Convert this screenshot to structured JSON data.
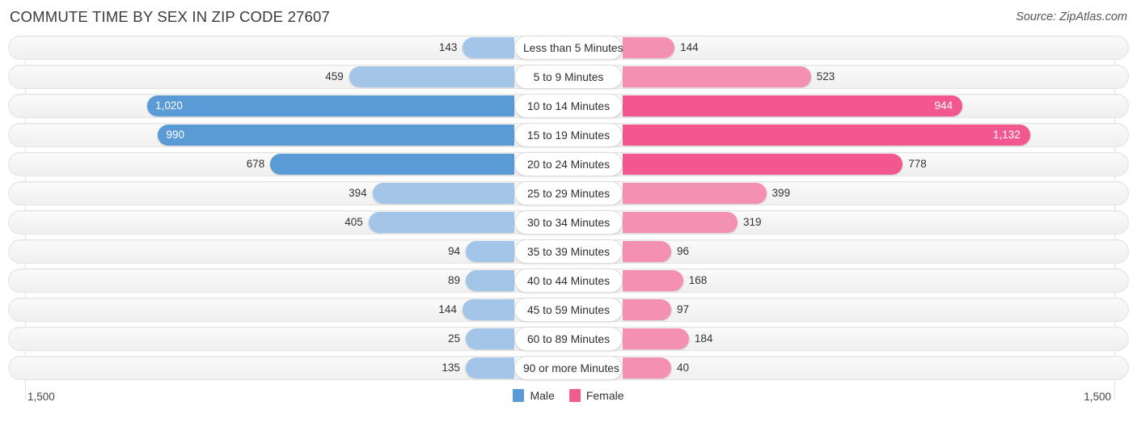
{
  "header": {
    "title": "COMMUTE TIME BY SEX IN ZIP CODE 27607",
    "source": "Source: ZipAtlas.com"
  },
  "legend": {
    "male_label": "Male",
    "female_label": "Female",
    "male_color": "#5B9BD5",
    "female_color": "#EE5E8C"
  },
  "axis": {
    "left_max": "1,500",
    "right_max": "1,500",
    "max_value": 1500
  },
  "palette": {
    "male_light": "#A3C6E8",
    "male_dark": "#5B9BD5",
    "female_light": "#F490B1",
    "female_dark": "#F2578F"
  },
  "chart_data": {
    "type": "bar",
    "title": "COMMUTE TIME BY SEX IN ZIP CODE 27607",
    "subtitle": "Source: ZipAtlas.com",
    "orientation": "horizontal-diverging",
    "xlabel": "",
    "ylabel": "",
    "xlim": [
      1500,
      1500
    ],
    "grid": true,
    "legend_position": "bottom-center",
    "categories": [
      "Less than 5 Minutes",
      "5 to 9 Minutes",
      "10 to 14 Minutes",
      "15 to 19 Minutes",
      "20 to 24 Minutes",
      "25 to 29 Minutes",
      "30 to 34 Minutes",
      "35 to 39 Minutes",
      "40 to 44 Minutes",
      "45 to 59 Minutes",
      "60 to 89 Minutes",
      "90 or more Minutes"
    ],
    "series": [
      {
        "name": "Male",
        "color": "#5B9BD5",
        "values": [
          143,
          459,
          1020,
          990,
          678,
          394,
          405,
          94,
          89,
          144,
          25,
          135
        ]
      },
      {
        "name": "Female",
        "color": "#EE5E8C",
        "values": [
          144,
          523,
          944,
          1132,
          778,
          399,
          319,
          96,
          168,
          97,
          184,
          40
        ]
      }
    ]
  },
  "rows": [
    {
      "label": "Less than 5 Minutes",
      "male": {
        "value": 143,
        "text": "143",
        "inside": false,
        "dark": false
      },
      "female": {
        "value": 144,
        "text": "144",
        "inside": false,
        "dark": false
      }
    },
    {
      "label": "5 to 9 Minutes",
      "male": {
        "value": 459,
        "text": "459",
        "inside": false,
        "dark": false
      },
      "female": {
        "value": 523,
        "text": "523",
        "inside": false,
        "dark": false
      }
    },
    {
      "label": "10 to 14 Minutes",
      "male": {
        "value": 1020,
        "text": "1,020",
        "inside": true,
        "dark": true
      },
      "female": {
        "value": 944,
        "text": "944",
        "inside": true,
        "dark": true
      }
    },
    {
      "label": "15 to 19 Minutes",
      "male": {
        "value": 990,
        "text": "990",
        "inside": true,
        "dark": true
      },
      "female": {
        "value": 1132,
        "text": "1,132",
        "inside": true,
        "dark": true
      }
    },
    {
      "label": "20 to 24 Minutes",
      "male": {
        "value": 678,
        "text": "678",
        "inside": false,
        "dark": true
      },
      "female": {
        "value": 778,
        "text": "778",
        "inside": false,
        "dark": true
      }
    },
    {
      "label": "25 to 29 Minutes",
      "male": {
        "value": 394,
        "text": "394",
        "inside": false,
        "dark": false
      },
      "female": {
        "value": 399,
        "text": "399",
        "inside": false,
        "dark": false
      }
    },
    {
      "label": "30 to 34 Minutes",
      "male": {
        "value": 405,
        "text": "405",
        "inside": false,
        "dark": false
      },
      "female": {
        "value": 319,
        "text": "319",
        "inside": false,
        "dark": false
      }
    },
    {
      "label": "35 to 39 Minutes",
      "male": {
        "value": 94,
        "text": "94",
        "inside": false,
        "dark": false
      },
      "female": {
        "value": 96,
        "text": "96",
        "inside": false,
        "dark": false
      }
    },
    {
      "label": "40 to 44 Minutes",
      "male": {
        "value": 89,
        "text": "89",
        "inside": false,
        "dark": false
      },
      "female": {
        "value": 168,
        "text": "168",
        "inside": false,
        "dark": false
      }
    },
    {
      "label": "45 to 59 Minutes",
      "male": {
        "value": 144,
        "text": "144",
        "inside": false,
        "dark": false
      },
      "female": {
        "value": 97,
        "text": "97",
        "inside": false,
        "dark": false
      }
    },
    {
      "label": "60 to 89 Minutes",
      "male": {
        "value": 25,
        "text": "25",
        "inside": false,
        "dark": false
      },
      "female": {
        "value": 184,
        "text": "184",
        "inside": false,
        "dark": false
      }
    },
    {
      "label": "90 or more Minutes",
      "male": {
        "value": 135,
        "text": "135",
        "inside": false,
        "dark": false
      },
      "female": {
        "value": 40,
        "text": "40",
        "inside": false,
        "dark": false
      }
    }
  ]
}
